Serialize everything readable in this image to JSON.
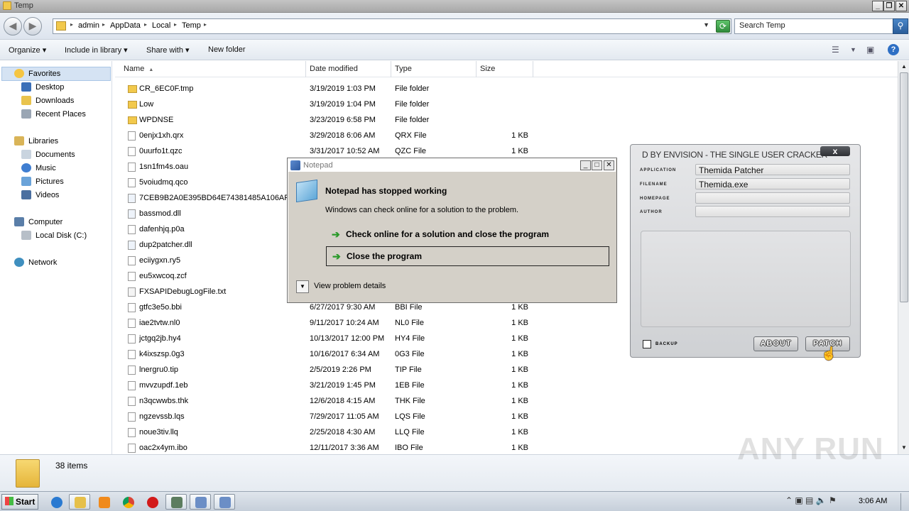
{
  "window": {
    "title": "Temp"
  },
  "address": {
    "crumbs": [
      "admin",
      "AppData",
      "Local",
      "Temp"
    ],
    "search_placeholder": "Search Temp"
  },
  "toolbar": {
    "organize": "Organize",
    "include_in_library": "Include in library",
    "share_with": "Share with",
    "new_folder": "New folder"
  },
  "nav": {
    "favorites": "Favorites",
    "desktop": "Desktop",
    "downloads": "Downloads",
    "recent_places": "Recent Places",
    "libraries": "Libraries",
    "documents": "Documents",
    "music": "Music",
    "pictures": "Pictures",
    "videos": "Videos",
    "computer": "Computer",
    "local_disk": "Local Disk (C:)",
    "network": "Network"
  },
  "columns": {
    "name": "Name",
    "date_modified": "Date modified",
    "type": "Type",
    "size": "Size"
  },
  "files": [
    {
      "name": "CR_6EC0F.tmp",
      "date": "3/19/2019 1:03 PM",
      "type": "File folder",
      "size": "",
      "kind": "folder"
    },
    {
      "name": "Low",
      "date": "3/19/2019 1:04 PM",
      "type": "File folder",
      "size": "",
      "kind": "folder"
    },
    {
      "name": "WPDNSE",
      "date": "3/23/2019 6:58 PM",
      "type": "File folder",
      "size": "",
      "kind": "folder"
    },
    {
      "name": "0enjx1xh.qrx",
      "date": "3/29/2018 6:06 AM",
      "type": "QRX File",
      "size": "1 KB",
      "kind": "file"
    },
    {
      "name": "0uurfo1t.qzc",
      "date": "3/31/2017 10:52 AM",
      "type": "QZC File",
      "size": "1 KB",
      "kind": "file"
    },
    {
      "name": "1sn1fm4s.oau",
      "date": "",
      "type": "",
      "size": "",
      "kind": "file"
    },
    {
      "name": "5voiudmq.qco",
      "date": "",
      "type": "",
      "size": "",
      "kind": "file"
    },
    {
      "name": "7CEB9B2A0E395BD64E74381485A106AF.d",
      "date": "",
      "type": "",
      "size": "",
      "kind": "file"
    },
    {
      "name": "bassmod.dll",
      "date": "",
      "type": "",
      "size": "",
      "kind": "dll"
    },
    {
      "name": "dafenhjq.p0a",
      "date": "",
      "type": "",
      "size": "",
      "kind": "file"
    },
    {
      "name": "dup2patcher.dll",
      "date": "",
      "type": "",
      "size": "",
      "kind": "dll"
    },
    {
      "name": "eciiygxn.ry5",
      "date": "",
      "type": "",
      "size": "",
      "kind": "file"
    },
    {
      "name": "eu5xwcoq.zcf",
      "date": "",
      "type": "",
      "size": "",
      "kind": "file"
    },
    {
      "name": "FXSAPIDebugLogFile.txt",
      "date": "",
      "type": "",
      "size": "",
      "kind": "file"
    },
    {
      "name": "gtfc3e5o.bbi",
      "date": "6/27/2017 9:30 AM",
      "type": "BBI File",
      "size": "1 KB",
      "kind": "file"
    },
    {
      "name": "iae2tvtw.nl0",
      "date": "9/11/2017 10:24 AM",
      "type": "NL0 File",
      "size": "1 KB",
      "kind": "file"
    },
    {
      "name": "jctgq2jb.hy4",
      "date": "10/13/2017 12:00 PM",
      "type": "HY4 File",
      "size": "1 KB",
      "kind": "file"
    },
    {
      "name": "k4ixszsp.0g3",
      "date": "10/16/2017 6:34 AM",
      "type": "0G3 File",
      "size": "1 KB",
      "kind": "file"
    },
    {
      "name": "lnergru0.tip",
      "date": "2/5/2019 2:26 PM",
      "type": "TIP File",
      "size": "1 KB",
      "kind": "file"
    },
    {
      "name": "mvvzupdf.1eb",
      "date": "3/21/2019 1:45 PM",
      "type": "1EB File",
      "size": "1 KB",
      "kind": "file"
    },
    {
      "name": "n3qcwwbs.thk",
      "date": "12/6/2018 4:15 AM",
      "type": "THK File",
      "size": "1 KB",
      "kind": "file"
    },
    {
      "name": "ngzevssb.lqs",
      "date": "7/29/2017 11:05 AM",
      "type": "LQS File",
      "size": "1 KB",
      "kind": "file"
    },
    {
      "name": "noue3tiv.llq",
      "date": "2/25/2018 4:30 AM",
      "type": "LLQ File",
      "size": "1 KB",
      "kind": "file"
    },
    {
      "name": "oac2x4ym.ibo",
      "date": "12/11/2017 3:36 AM",
      "type": "IBO File",
      "size": "1 KB",
      "kind": "file"
    }
  ],
  "details": {
    "count": "38 items"
  },
  "watermark": "ANY RUN",
  "dialog": {
    "title": "Notepad",
    "heading": "Notepad has stopped working",
    "subtext": "Windows can check online for a solution to the problem.",
    "option_check": "Check online for a solution and close the program",
    "option_close": "Close the program",
    "view_details": "View problem details"
  },
  "cracker": {
    "title": "D BY ENVISION - THE SINGLE USER CRACKER",
    "close": "x",
    "label_application": "application",
    "label_filename": "filename",
    "label_homepage": "homepage",
    "label_author": "author",
    "application": "Themida Patcher",
    "filename": "Themida.exe",
    "homepage": "",
    "author": "",
    "backup": "backup",
    "about": "ABOUT",
    "patch": "PATCH"
  },
  "taskbar": {
    "start": "Start",
    "clock": "3:06 AM"
  },
  "colors": {
    "folder": "#f2c94c",
    "selection": "#d5e3f3",
    "accent_green": "#2a9a2a"
  }
}
